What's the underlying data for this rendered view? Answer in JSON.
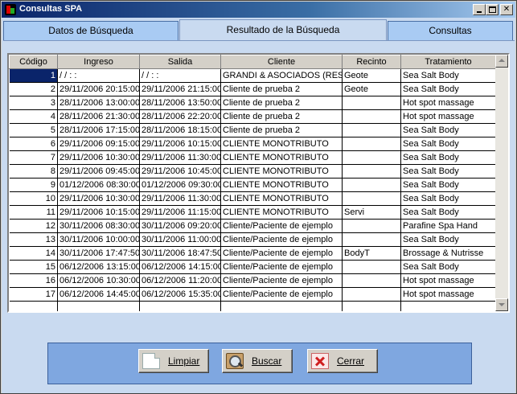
{
  "window": {
    "title": "Consultas SPA"
  },
  "tabs": [
    {
      "label": "Datos de Búsqueda"
    },
    {
      "label": "Resultado de la Búsqueda"
    },
    {
      "label": "Consultas"
    }
  ],
  "grid": {
    "columns": [
      "Código",
      "Ingreso",
      "Salida",
      "Cliente",
      "Recinto",
      "Tratamiento"
    ],
    "rows": [
      [
        "1",
        "/ /     :  :",
        "/ /     :  :",
        "GRANDI & ASOCIADOS (RESP",
        "Geote",
        "Sea Salt Body"
      ],
      [
        "2",
        "29/11/2006 20:15:00",
        "29/11/2006 21:15:00",
        "Cliente de prueba 2",
        "Geote",
        "Sea Salt Body"
      ],
      [
        "3",
        "28/11/2006 13:00:00",
        "28/11/2006 13:50:00",
        "Cliente de prueba 2",
        "",
        "Hot spot massage"
      ],
      [
        "4",
        "28/11/2006 21:30:00",
        "28/11/2006 22:20:00",
        "Cliente de prueba 2",
        "",
        "Hot spot massage"
      ],
      [
        "5",
        "28/11/2006 17:15:00",
        "28/11/2006 18:15:00",
        "Cliente de prueba 2",
        "",
        "Sea Salt Body"
      ],
      [
        "6",
        "29/11/2006 09:15:00",
        "29/11/2006 10:15:00",
        "CLIENTE MONOTRIBUTO",
        "",
        "Sea Salt Body"
      ],
      [
        "7",
        "29/11/2006 10:30:00",
        "29/11/2006 11:30:00",
        "CLIENTE MONOTRIBUTO",
        "",
        "Sea Salt Body"
      ],
      [
        "8",
        "29/11/2006 09:45:00",
        "29/11/2006 10:45:00",
        "CLIENTE MONOTRIBUTO",
        "",
        "Sea Salt Body"
      ],
      [
        "9",
        "01/12/2006 08:30:00",
        "01/12/2006 09:30:00",
        "CLIENTE MONOTRIBUTO",
        "",
        "Sea Salt Body"
      ],
      [
        "10",
        "29/11/2006 10:30:00",
        "29/11/2006 11:30:00",
        "CLIENTE MONOTRIBUTO",
        "",
        "Sea Salt Body"
      ],
      [
        "11",
        "29/11/2006 10:15:00",
        "29/11/2006 11:15:00",
        "CLIENTE MONOTRIBUTO",
        "Servi",
        "Sea Salt Body"
      ],
      [
        "12",
        "30/11/2006 08:30:00",
        "30/11/2006 09:20:00",
        "Cliente/Paciente de ejemplo",
        "",
        "Parafine Spa Hand"
      ],
      [
        "13",
        "30/11/2006 10:00:00",
        "30/11/2006 11:00:00",
        "Cliente/Paciente de ejemplo",
        "",
        "Sea Salt Body"
      ],
      [
        "14",
        "30/11/2006 17:47:50",
        "30/11/2006 18:47:50",
        "Cliente/Paciente de ejemplo",
        "BodyT",
        "Brossage & Nutrisse"
      ],
      [
        "15",
        "06/12/2006 13:15:00",
        "06/12/2006 14:15:00",
        "Cliente/Paciente de ejemplo",
        "",
        "Sea Salt Body"
      ],
      [
        "16",
        "06/12/2006 10:30:00",
        "06/12/2006 11:20:00",
        "Cliente/Paciente de ejemplo",
        "",
        "Hot spot massage"
      ],
      [
        "17",
        "06/12/2006 14:45:00",
        "06/12/2006 15:35:00",
        "Cliente/Paciente de ejemplo",
        "",
        "Hot spot massage"
      ]
    ],
    "selected_row": 0
  },
  "buttons": {
    "limpiar": "Limpiar",
    "buscar": "Buscar",
    "cerrar": "Cerrar"
  },
  "icons": {
    "app": "spa-app-icon",
    "limpiar": "blank-document-icon",
    "buscar": "magnifier-icon",
    "cerrar": "red-x-icon"
  }
}
